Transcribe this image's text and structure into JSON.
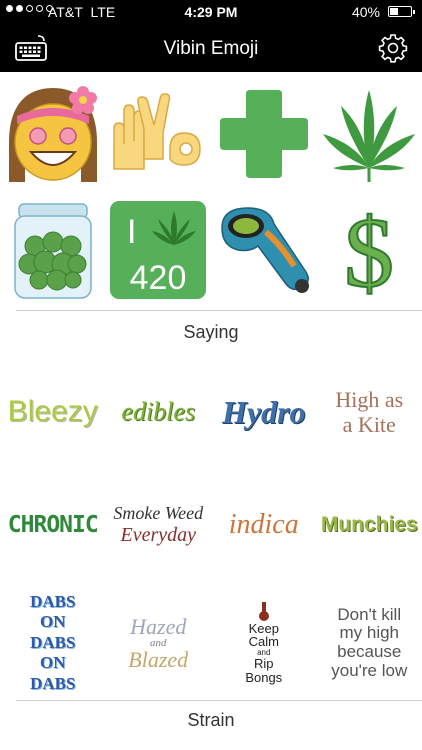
{
  "status_bar": {
    "carrier": "AT&T",
    "network": "LTE",
    "time": "4:29 PM",
    "battery": "40%",
    "battery_level": 0.4
  },
  "nav": {
    "title": "Vibin Emoji"
  },
  "emoji_row1": [
    {
      "name": "hippie-girl-emoji",
      "icon": "hippie-girl-face"
    },
    {
      "name": "hand-signs-420-emoji",
      "icon": "hand-signs"
    },
    {
      "name": "green-cross-emoji",
      "icon": "green-cross"
    },
    {
      "name": "cannabis-leaf-emoji",
      "icon": "cannabis-leaf"
    }
  ],
  "emoji_row2": [
    {
      "name": "weed-jar-emoji",
      "icon": "jar"
    },
    {
      "name": "i-leaf-420-emoji",
      "icon": "i-leaf-420",
      "top_text": "I",
      "bottom_text": "420"
    },
    {
      "name": "glass-pipe-emoji",
      "icon": "pipe"
    },
    {
      "name": "dollar-leaf-emoji",
      "icon": "dollar-leaf",
      "text": "$"
    }
  ],
  "sections": {
    "saying": "Saying",
    "strain": "Strain"
  },
  "sayings_row1": [
    {
      "text": "Bleezy"
    },
    {
      "text": "edibles"
    },
    {
      "text": "Hydro"
    },
    {
      "text": "High as",
      "text2": "a Kite"
    }
  ],
  "sayings_row2": [
    {
      "text": "CHRONIC"
    },
    {
      "text": "Smoke Weed",
      "text2": "Everyday"
    },
    {
      "text": "indica"
    },
    {
      "text": "Munchies"
    }
  ],
  "sayings_row3": [
    {
      "text": "DABS",
      "text2": "ON",
      "text3": "DABS",
      "text4": "ON",
      "text5": "DABS"
    },
    {
      "text": "Hazed",
      "text2": "and",
      "text3": "Blazed"
    },
    {
      "text": "Keep",
      "text2": "Calm",
      "text3": "and",
      "text4": "Rip",
      "text5": "Bongs"
    },
    {
      "text": "Don't kill",
      "text2": "my high",
      "text3": "because",
      "text4": "you're low"
    }
  ],
  "colors": {
    "bar": "#000000",
    "green": "#56b05a",
    "leaf": "#3f9a3f",
    "divider": "#cfcfcf"
  }
}
